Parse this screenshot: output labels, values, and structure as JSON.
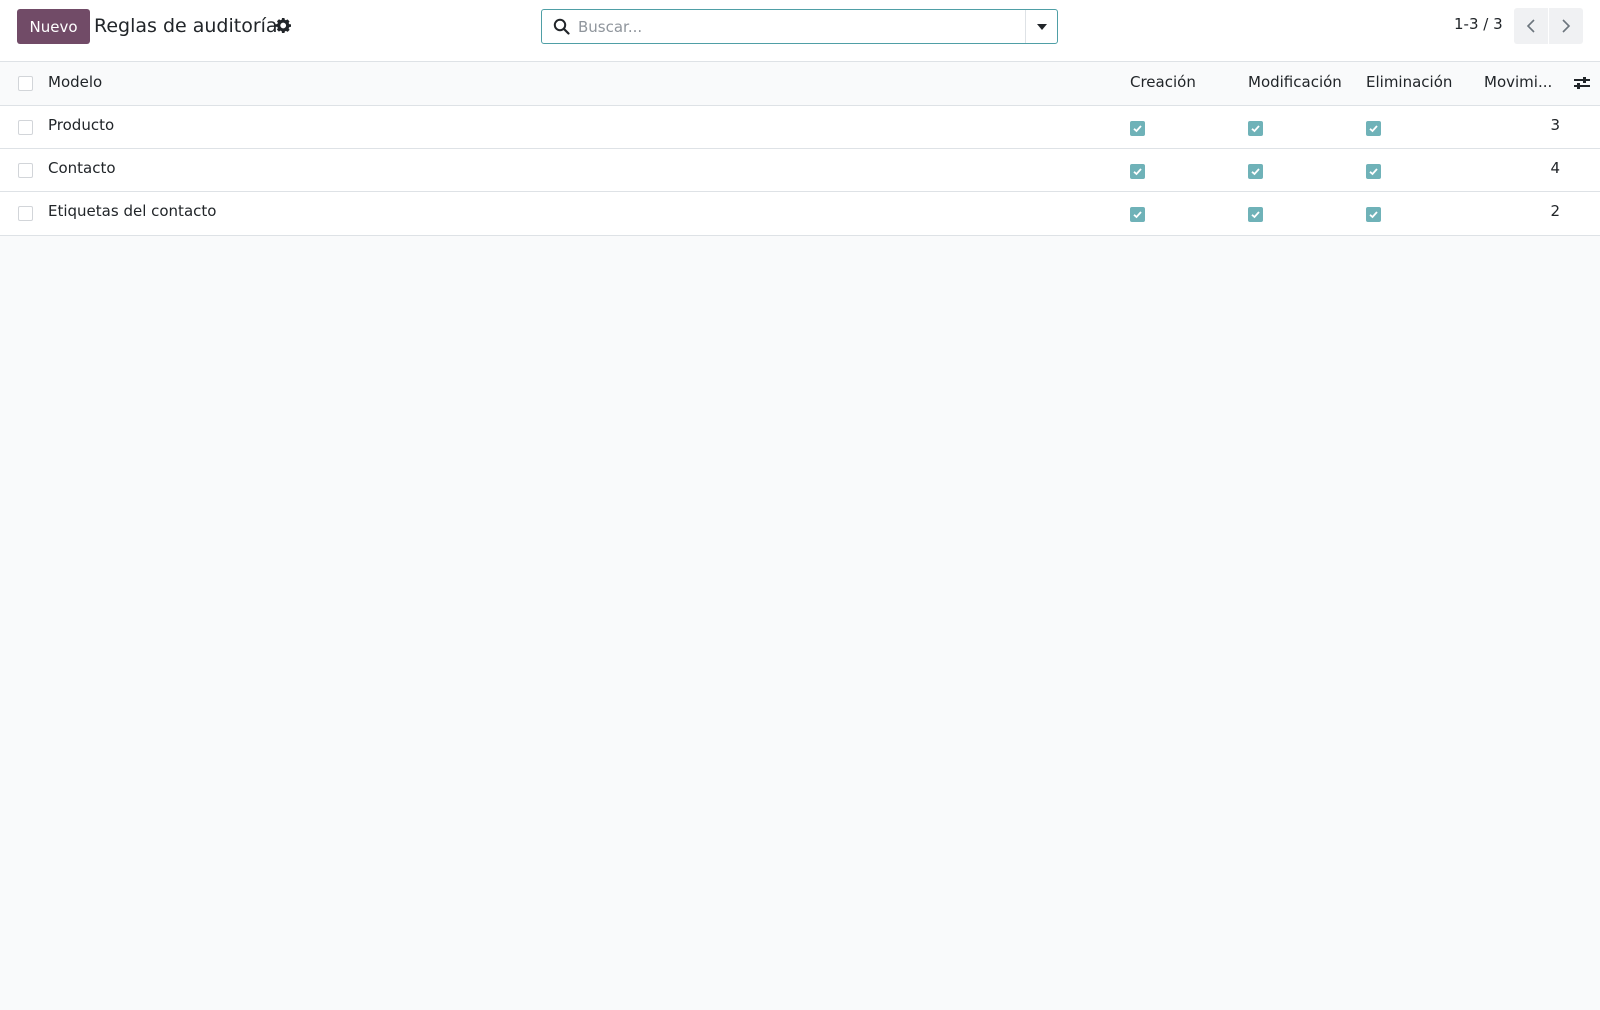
{
  "control_panel": {
    "new_button": "Nuevo",
    "title": "Reglas de auditoría",
    "search_placeholder": "Buscar...",
    "pager": "1-3 / 3"
  },
  "list": {
    "columns": {
      "model": "Modelo",
      "create": "Creación",
      "modify": "Modificación",
      "delete": "Eliminación",
      "moves": "Movimi..."
    },
    "rows": [
      {
        "model": "Producto",
        "create": true,
        "modify": true,
        "delete": true,
        "moves": "3"
      },
      {
        "model": "Contacto",
        "create": true,
        "modify": true,
        "delete": true,
        "moves": "4"
      },
      {
        "model": "Etiquetas del contacto",
        "create": true,
        "modify": true,
        "delete": true,
        "moves": "2"
      }
    ]
  },
  "colors": {
    "primary": "#714b67",
    "checkbox_checked": "#6fb2b8",
    "search_border": "#4f9fa6"
  },
  "icons": [
    "gear-icon",
    "search-icon",
    "caret-down-icon",
    "chevron-left-icon",
    "chevron-right-icon",
    "check-icon",
    "sliders-icon"
  ]
}
